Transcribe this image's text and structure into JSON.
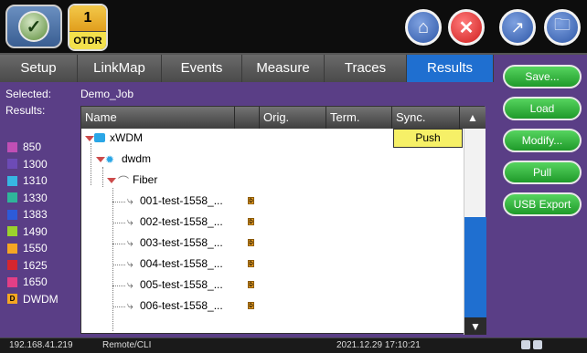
{
  "header": {
    "module_number": "1",
    "module_name": "OTDR",
    "app_icon": "check-icon",
    "home_icon": "home-icon",
    "close_icon": "close-icon"
  },
  "right_panel": {
    "top_icon_1": "graph-icon",
    "top_icon_2": "folder-icon",
    "buttons": [
      {
        "label": "Save..."
      },
      {
        "label": "Load"
      },
      {
        "label": "Modify..."
      },
      {
        "label": "Pull"
      },
      {
        "label": "USB Export"
      }
    ]
  },
  "tabs": [
    {
      "label": "Setup"
    },
    {
      "label": "LinkMap"
    },
    {
      "label": "Events"
    },
    {
      "label": "Measure"
    },
    {
      "label": "Traces"
    },
    {
      "label": "Results",
      "active": true
    }
  ],
  "info": {
    "selected_label": "Selected:",
    "selected_value": "Demo_Job",
    "results_label": "Results:"
  },
  "legend": [
    {
      "label": "850",
      "color": "#c04fb5"
    },
    {
      "label": "1300",
      "color": "#6d4bb6"
    },
    {
      "label": "1310",
      "color": "#37b6e2"
    },
    {
      "label": "1330",
      "color": "#2fb59a"
    },
    {
      "label": "1383",
      "color": "#2d5bd9"
    },
    {
      "label": "1490",
      "color": "#9bd12d"
    },
    {
      "label": "1550",
      "color": "#f6a623"
    },
    {
      "label": "1625",
      "color": "#d6262e"
    },
    {
      "label": "1650",
      "color": "#e23f86"
    },
    {
      "label": "DWDM",
      "color": "#f6a623",
      "badge": "D"
    }
  ],
  "table": {
    "columns": [
      {
        "label": "Name"
      },
      {
        "label": ""
      },
      {
        "label": "Orig."
      },
      {
        "label": "Term."
      },
      {
        "label": "Sync."
      }
    ],
    "sort_icon": "triangle-up-icon",
    "scroll_down_icon": "triangle-down-icon",
    "push_label": "Push",
    "tree": {
      "root": "xWDM",
      "child": "dwdm",
      "fiber": "Fiber",
      "items": [
        "001-test-1558_...",
        "002-test-1558_...",
        "003-test-1558_...",
        "004-test-1558_...",
        "005-test-1558_...",
        "006-test-1558_..."
      ]
    }
  },
  "statusbar": {
    "ip": "192.168.41.219",
    "remote": "Remote/CLI",
    "datetime": "2021.12.29 17:10:21"
  }
}
